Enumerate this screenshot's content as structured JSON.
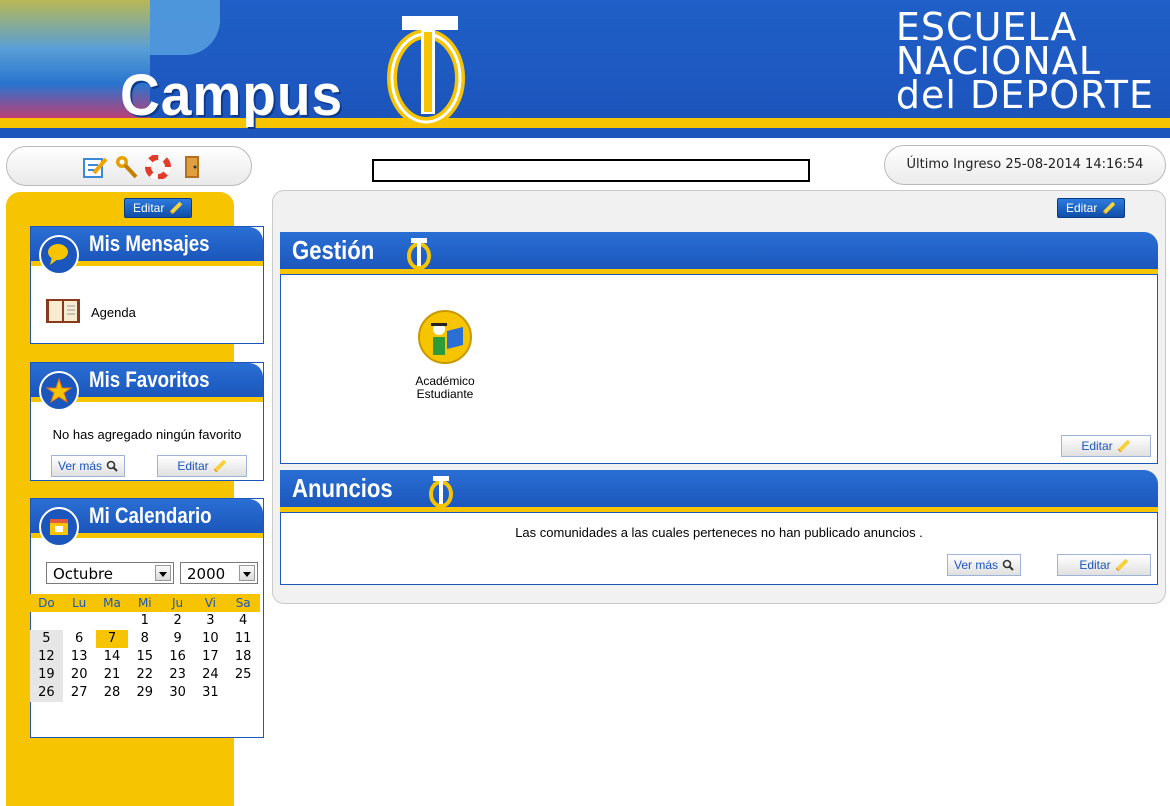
{
  "header": {
    "logo_text": "Campus",
    "school_lines": [
      "ESCUELA",
      "NACIONAL",
      "del DEPORTE"
    ]
  },
  "toolbar": {
    "icons": [
      "edit-icon",
      "tools-icon",
      "lifebuoy-icon",
      "exit-door-icon"
    ]
  },
  "top": {
    "last_login": "Último Ingreso 25-08-2014 14:16:54"
  },
  "left": {
    "edit_label": "Editar",
    "messages": {
      "title": "Mis Mensajes",
      "agenda_label": "Agenda"
    },
    "favorites": {
      "title": "Mis Favoritos",
      "empty_text": "No has agregado ningún favorito",
      "more_label": "Ver más",
      "edit_label": "Editar"
    },
    "calendar": {
      "title": "Mi Calendario",
      "month": "Octubre",
      "year": "2000",
      "weekdays": [
        "Do",
        "Lu",
        "Ma",
        "Mi",
        "Ju",
        "Vi",
        "Sa"
      ],
      "weeks": [
        [
          "",
          "",
          "",
          "1",
          "2",
          "3",
          "4"
        ],
        [
          "5",
          "6",
          "7",
          "8",
          "9",
          "10",
          "11"
        ],
        [
          "12",
          "13",
          "14",
          "15",
          "16",
          "17",
          "18"
        ],
        [
          "19",
          "20",
          "21",
          "22",
          "23",
          "24",
          "25"
        ],
        [
          "26",
          "27",
          "28",
          "29",
          "30",
          "31",
          ""
        ]
      ],
      "selected_day": "7"
    }
  },
  "main": {
    "edit_label": "Editar",
    "gestion": {
      "title": "Gestión",
      "app_label_line1": "Académico",
      "app_label_line2": "Estudiante",
      "edit_label": "Editar"
    },
    "anuncios": {
      "title": "Anuncios",
      "message": "Las comunidades a las cuales perteneces no han publicado anuncios .",
      "more_label": "Ver más",
      "edit_label": "Editar"
    }
  },
  "colors": {
    "blue": "#1b56bc",
    "yellow": "#f6c400"
  }
}
